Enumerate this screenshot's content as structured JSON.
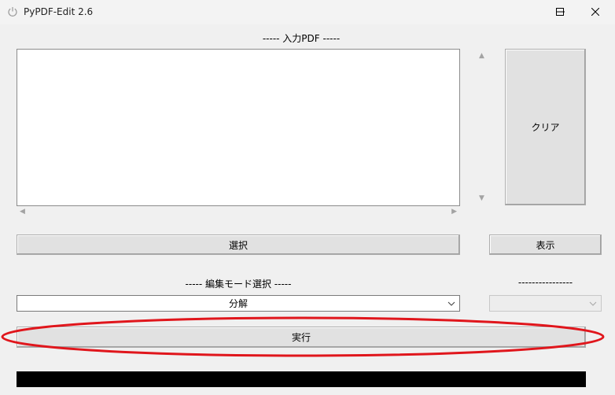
{
  "window": {
    "title": "PyPDF-Edit 2.6",
    "icons": {
      "app": "power-icon",
      "minimize": "minimize-icon",
      "maximize": "maximize-icon",
      "close": "close-icon"
    }
  },
  "input_section": {
    "label": "----- 入力PDF -----",
    "files": [],
    "clear_button": "クリア",
    "select_button": "選択",
    "show_button": "表示"
  },
  "mode_section": {
    "label": "----- 編集モード選択 -----",
    "selected_mode": "分解",
    "sub_label": "----------------",
    "sub_selected": ""
  },
  "run_button": "実行",
  "progress": {
    "value": 0
  },
  "annotation": {
    "color": "#e0161c"
  }
}
